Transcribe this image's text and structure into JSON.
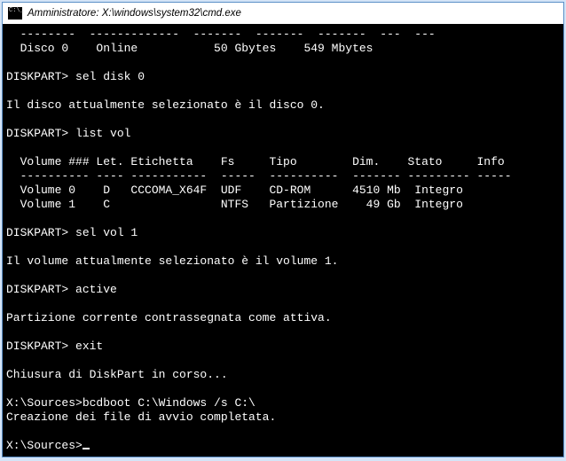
{
  "window": {
    "title": "Amministratore: X:\\windows\\system32\\cmd.exe"
  },
  "terminal": {
    "disk_list_sep": "  --------  -------------  -------  -------  -------  ---  ---",
    "disk_row": "  Disco 0    Online           50 Gbytes    549 Mbytes",
    "prompt1": "DISKPART> sel disk 0",
    "resp1": "Il disco attualmente selezionato è il disco 0.",
    "prompt2": "DISKPART> list vol",
    "vol_header": "  Volume ### Let. Etichetta    Fs     Tipo        Dim.    Stato     Info",
    "vol_sep": "  ---------- ---- -----------  -----  ----------  ------- --------- -----",
    "vol_row0": "  Volume 0    D   CCCOMA_X64F  UDF    CD-ROM      4510 Mb  Integro",
    "vol_row1": "  Volume 1    C                NTFS   Partizione    49 Gb  Integro",
    "prompt3": "DISKPART> sel vol 1",
    "resp3": "Il volume attualmente selezionato è il volume 1.",
    "prompt4": "DISKPART> active",
    "resp4": "Partizione corrente contrassegnata come attiva.",
    "prompt5": "DISKPART> exit",
    "resp5": "Chiusura di DiskPart in corso...",
    "prompt6": "X:\\Sources>bcdboot C:\\Windows /s C:\\",
    "resp6": "Creazione dei file di avvio completata.",
    "prompt7": "X:\\Sources>"
  }
}
